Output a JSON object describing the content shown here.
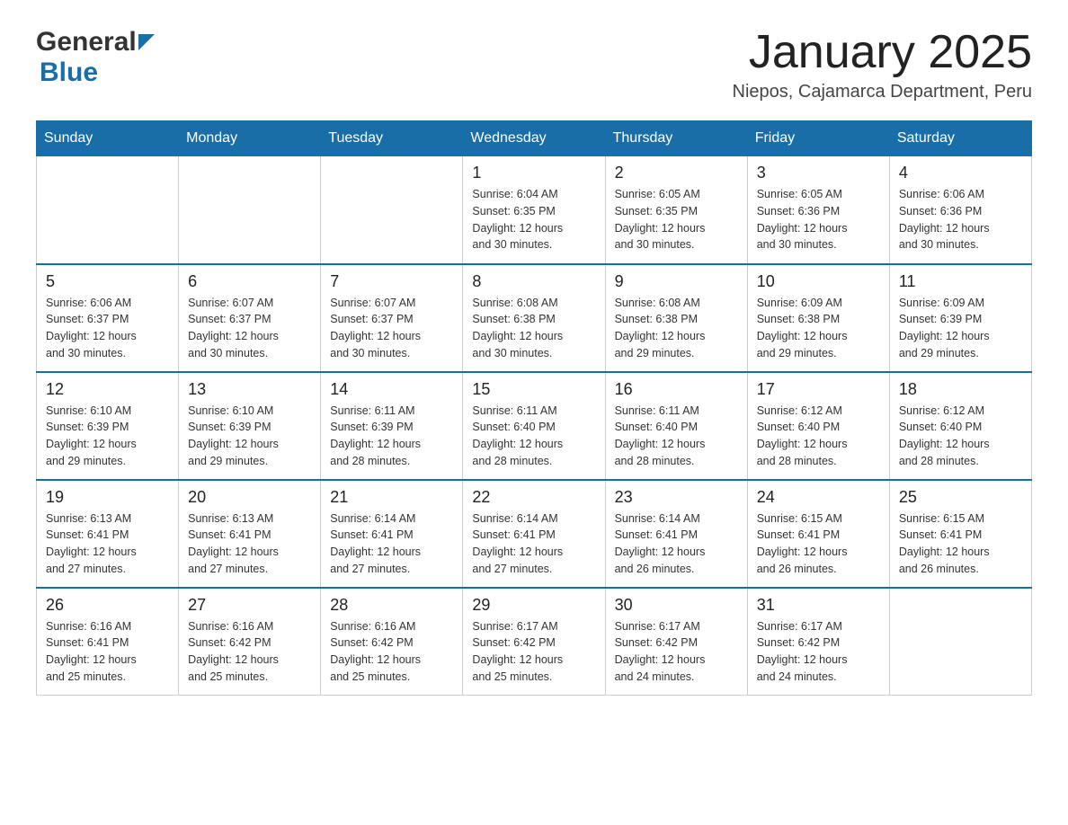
{
  "header": {
    "title": "January 2025",
    "location": "Niepos, Cajamarca Department, Peru"
  },
  "logo": {
    "general": "General",
    "blue": "Blue"
  },
  "days": [
    "Sunday",
    "Monday",
    "Tuesday",
    "Wednesday",
    "Thursday",
    "Friday",
    "Saturday"
  ],
  "weeks": [
    [
      {
        "num": "",
        "info": ""
      },
      {
        "num": "",
        "info": ""
      },
      {
        "num": "",
        "info": ""
      },
      {
        "num": "1",
        "info": "Sunrise: 6:04 AM\nSunset: 6:35 PM\nDaylight: 12 hours\nand 30 minutes."
      },
      {
        "num": "2",
        "info": "Sunrise: 6:05 AM\nSunset: 6:35 PM\nDaylight: 12 hours\nand 30 minutes."
      },
      {
        "num": "3",
        "info": "Sunrise: 6:05 AM\nSunset: 6:36 PM\nDaylight: 12 hours\nand 30 minutes."
      },
      {
        "num": "4",
        "info": "Sunrise: 6:06 AM\nSunset: 6:36 PM\nDaylight: 12 hours\nand 30 minutes."
      }
    ],
    [
      {
        "num": "5",
        "info": "Sunrise: 6:06 AM\nSunset: 6:37 PM\nDaylight: 12 hours\nand 30 minutes."
      },
      {
        "num": "6",
        "info": "Sunrise: 6:07 AM\nSunset: 6:37 PM\nDaylight: 12 hours\nand 30 minutes."
      },
      {
        "num": "7",
        "info": "Sunrise: 6:07 AM\nSunset: 6:37 PM\nDaylight: 12 hours\nand 30 minutes."
      },
      {
        "num": "8",
        "info": "Sunrise: 6:08 AM\nSunset: 6:38 PM\nDaylight: 12 hours\nand 30 minutes."
      },
      {
        "num": "9",
        "info": "Sunrise: 6:08 AM\nSunset: 6:38 PM\nDaylight: 12 hours\nand 29 minutes."
      },
      {
        "num": "10",
        "info": "Sunrise: 6:09 AM\nSunset: 6:38 PM\nDaylight: 12 hours\nand 29 minutes."
      },
      {
        "num": "11",
        "info": "Sunrise: 6:09 AM\nSunset: 6:39 PM\nDaylight: 12 hours\nand 29 minutes."
      }
    ],
    [
      {
        "num": "12",
        "info": "Sunrise: 6:10 AM\nSunset: 6:39 PM\nDaylight: 12 hours\nand 29 minutes."
      },
      {
        "num": "13",
        "info": "Sunrise: 6:10 AM\nSunset: 6:39 PM\nDaylight: 12 hours\nand 29 minutes."
      },
      {
        "num": "14",
        "info": "Sunrise: 6:11 AM\nSunset: 6:39 PM\nDaylight: 12 hours\nand 28 minutes."
      },
      {
        "num": "15",
        "info": "Sunrise: 6:11 AM\nSunset: 6:40 PM\nDaylight: 12 hours\nand 28 minutes."
      },
      {
        "num": "16",
        "info": "Sunrise: 6:11 AM\nSunset: 6:40 PM\nDaylight: 12 hours\nand 28 minutes."
      },
      {
        "num": "17",
        "info": "Sunrise: 6:12 AM\nSunset: 6:40 PM\nDaylight: 12 hours\nand 28 minutes."
      },
      {
        "num": "18",
        "info": "Sunrise: 6:12 AM\nSunset: 6:40 PM\nDaylight: 12 hours\nand 28 minutes."
      }
    ],
    [
      {
        "num": "19",
        "info": "Sunrise: 6:13 AM\nSunset: 6:41 PM\nDaylight: 12 hours\nand 27 minutes."
      },
      {
        "num": "20",
        "info": "Sunrise: 6:13 AM\nSunset: 6:41 PM\nDaylight: 12 hours\nand 27 minutes."
      },
      {
        "num": "21",
        "info": "Sunrise: 6:14 AM\nSunset: 6:41 PM\nDaylight: 12 hours\nand 27 minutes."
      },
      {
        "num": "22",
        "info": "Sunrise: 6:14 AM\nSunset: 6:41 PM\nDaylight: 12 hours\nand 27 minutes."
      },
      {
        "num": "23",
        "info": "Sunrise: 6:14 AM\nSunset: 6:41 PM\nDaylight: 12 hours\nand 26 minutes."
      },
      {
        "num": "24",
        "info": "Sunrise: 6:15 AM\nSunset: 6:41 PM\nDaylight: 12 hours\nand 26 minutes."
      },
      {
        "num": "25",
        "info": "Sunrise: 6:15 AM\nSunset: 6:41 PM\nDaylight: 12 hours\nand 26 minutes."
      }
    ],
    [
      {
        "num": "26",
        "info": "Sunrise: 6:16 AM\nSunset: 6:41 PM\nDaylight: 12 hours\nand 25 minutes."
      },
      {
        "num": "27",
        "info": "Sunrise: 6:16 AM\nSunset: 6:42 PM\nDaylight: 12 hours\nand 25 minutes."
      },
      {
        "num": "28",
        "info": "Sunrise: 6:16 AM\nSunset: 6:42 PM\nDaylight: 12 hours\nand 25 minutes."
      },
      {
        "num": "29",
        "info": "Sunrise: 6:17 AM\nSunset: 6:42 PM\nDaylight: 12 hours\nand 25 minutes."
      },
      {
        "num": "30",
        "info": "Sunrise: 6:17 AM\nSunset: 6:42 PM\nDaylight: 12 hours\nand 24 minutes."
      },
      {
        "num": "31",
        "info": "Sunrise: 6:17 AM\nSunset: 6:42 PM\nDaylight: 12 hours\nand 24 minutes."
      },
      {
        "num": "",
        "info": ""
      }
    ]
  ]
}
